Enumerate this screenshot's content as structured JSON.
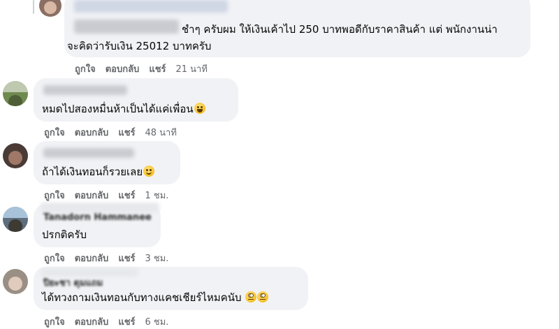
{
  "comments": [
    {
      "text_line1": "ชำๆ ครับผม ให้เงินเค้าไป 250 บาทพอดีกับราคาสินค้า แต่ พนักงานน่า",
      "text_line2": "จะคิดว่ารับเงิน 25012 บาทครับ",
      "like": "ถูกใจ",
      "reply": "ตอบกลับ",
      "share": "แชร์",
      "time": "21 นาที"
    },
    {
      "text": "หมดไปสองหมื่นห้าเป็นได้แค่เพื่อน",
      "emoji": "laughing-emoji",
      "like": "ถูกใจ",
      "reply": "ตอบกลับ",
      "share": "แชร์",
      "time": "48 นาที"
    },
    {
      "text": "ถ้าได้เงินทอนก็รวยเลย",
      "emoji": "smile-emoji",
      "like": "ถูกใจ",
      "reply": "ตอบกลับ",
      "share": "แชร์",
      "time": "1 ชม."
    },
    {
      "name": "Tanadorn Hammanee",
      "text": "ปรกติครับ",
      "like": "ถูกใจ",
      "reply": "ตอบกลับ",
      "share": "แชร์",
      "time": "3 ชม."
    },
    {
      "name": "ปิยะชา ดุมแถม",
      "text": "ได้ทวงถามเงินทอนกับทางแคชเชียร์ไหมคนับ",
      "emoji": "eye-roll-emoji",
      "like": "ถูกใจ",
      "reply": "ตอบกลับ",
      "share": "แชร์",
      "time": "6 ชม."
    }
  ]
}
